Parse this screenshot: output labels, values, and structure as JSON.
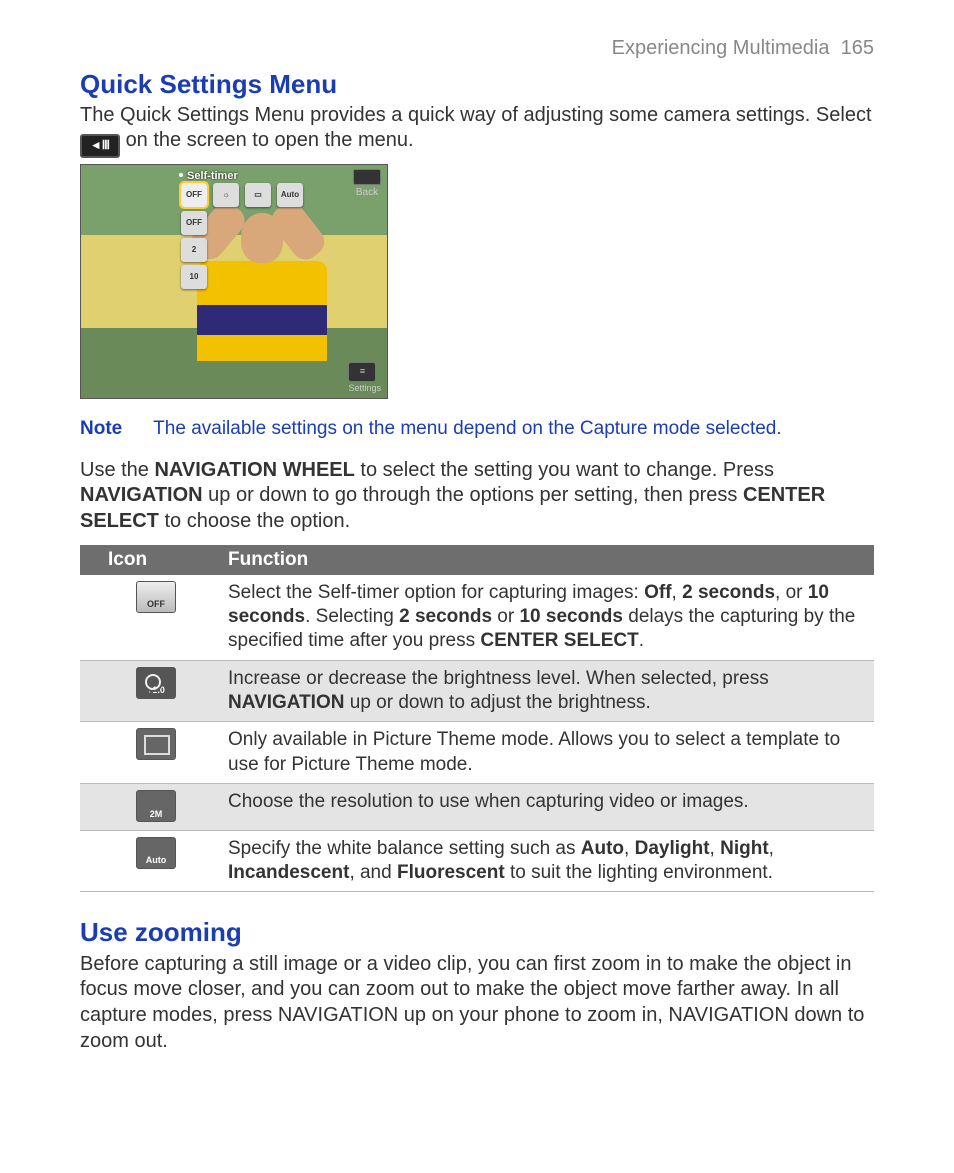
{
  "header": {
    "section": "Experiencing Multimedia",
    "page": "165"
  },
  "h1": "Quick Settings Menu",
  "intro1a": "The Quick Settings Menu provides a quick way of adjusting some camera settings. Select ",
  "intro1b": " on the screen to open the menu.",
  "screenshot": {
    "toplabel": "Self-timer",
    "back": "Back",
    "settings": "Settings",
    "icons": {
      "off": "OFF",
      "two": "2",
      "ten": "10",
      "auto": "Auto"
    }
  },
  "note": {
    "label": "Note",
    "text": "The available settings on the menu depend on the Capture mode selected."
  },
  "instr": {
    "a": "Use the ",
    "nav_wheel": "NAVIGATION WHEEL",
    "b": " to select the setting you want to change. Press ",
    "nav": "NAVIGATION",
    "c": " up or down to go through the options per setting, then press ",
    "center": "CENTER SELECT",
    "d": " to choose the option."
  },
  "table": {
    "head_icon": "Icon",
    "head_func": "Function",
    "rows": [
      {
        "icon": "OFF",
        "parts": [
          "Select the Self-timer option for capturing images: ",
          "Off",
          ", ",
          "2 seconds",
          ", or ",
          "10 seconds",
          ". Selecting ",
          "2 seconds",
          " or ",
          "10 seconds",
          " delays the capturing by the specified time after you press ",
          "CENTER SELECT",
          "."
        ]
      },
      {
        "icon": "+1.0",
        "parts": [
          "Increase or decrease the brightness level. When selected, press ",
          "NAVIGATION",
          " up or down to adjust the brightness."
        ]
      },
      {
        "icon": "",
        "parts": [
          "Only available in Picture Theme mode. Allows you to select a template to use for Picture Theme mode."
        ]
      },
      {
        "icon": "2M",
        "parts": [
          "Choose the resolution to use when capturing video or images."
        ]
      },
      {
        "icon": "Auto",
        "parts": [
          "Specify the white balance setting such as ",
          "Auto",
          ", ",
          "Daylight",
          ", ",
          "Night",
          ", ",
          "Incandescent",
          ", and ",
          "Fluorescent",
          " to suit the lighting environment."
        ]
      }
    ]
  },
  "h2": "Use zooming",
  "zoom_text": "Before capturing a still image or a video clip, you can first zoom in to make the object in focus move closer, and you can zoom out to make the object move farther away. In all capture modes, press NAVIGATION up on your phone to zoom in, NAVIGATION down to zoom out."
}
